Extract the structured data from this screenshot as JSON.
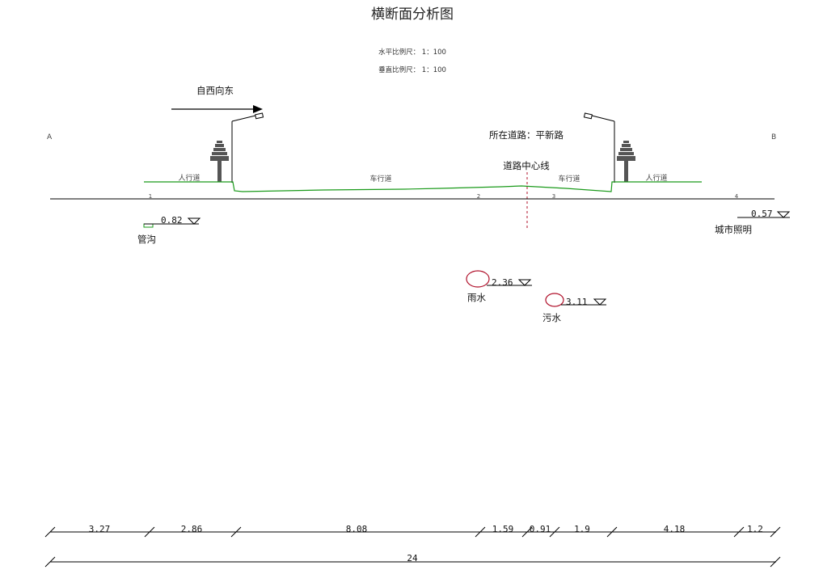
{
  "title": "横断面分析图",
  "scale": {
    "horizontal": "水平比例尺： 1：100",
    "vertical": "垂直比例尺： 1：100"
  },
  "direction_label": "自西向东",
  "endpoint_a": "A",
  "endpoint_b": "B",
  "road_name_label": "所在道路：平新路",
  "centerline_label": "道路中心线",
  "lanes": {
    "sidewalk_left": "人行道",
    "carriageway_left": "车行道",
    "carriageway_right": "车行道",
    "sidewalk_right": "人行道"
  },
  "ground_points": [
    "1",
    "2",
    "3",
    "4"
  ],
  "utilities": [
    {
      "name": "管沟",
      "depth": "0.82"
    },
    {
      "name": "城市照明",
      "depth": "0.57"
    },
    {
      "name": "雨水",
      "depth": "2.36"
    },
    {
      "name": "污水",
      "depth": "3.11"
    }
  ],
  "segments": [
    "3.27",
    "2.86",
    "8.08",
    "1.59",
    "0.91",
    "1.9",
    "4.18",
    "1.2"
  ],
  "total_width": "24",
  "colors": {
    "road_profile": "#1a9a1a",
    "pipe": "#b0102a",
    "centerline": "#b0102a",
    "tree": "#555555"
  }
}
